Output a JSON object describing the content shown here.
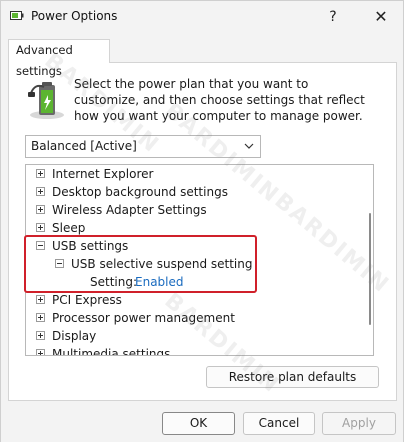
{
  "window": {
    "title": "Power Options",
    "help_glyph": "?",
    "close_glyph": "✕"
  },
  "tab": {
    "label": "Advanced settings"
  },
  "description": "Select the power plan that you want to customize, and then choose settings that reflect how you want your computer to manage power.",
  "plan_select": {
    "value": "Balanced [Active]"
  },
  "tree": {
    "items": [
      {
        "label": "Internet Explorer",
        "expanded": false,
        "level": 0
      },
      {
        "label": "Desktop background settings",
        "expanded": false,
        "level": 0
      },
      {
        "label": "Wireless Adapter Settings",
        "expanded": false,
        "level": 0
      },
      {
        "label": "Sleep",
        "expanded": false,
        "level": 0
      },
      {
        "label": "USB settings",
        "expanded": true,
        "level": 0
      },
      {
        "label": "USB selective suspend setting",
        "expanded": true,
        "level": 1
      },
      {
        "setting_label": "Setting:",
        "setting_value": "Enabled",
        "level": 2
      },
      {
        "label": "PCI Express",
        "expanded": false,
        "level": 0
      },
      {
        "label": "Processor power management",
        "expanded": false,
        "level": 0
      },
      {
        "label": "Display",
        "expanded": false,
        "level": 0
      },
      {
        "label": "Multimedia settings",
        "expanded": false,
        "level": 0
      }
    ]
  },
  "buttons": {
    "restore": "Restore plan defaults",
    "ok": "OK",
    "cancel": "Cancel",
    "apply": "Apply"
  },
  "watermark_text": "BARDIMIN",
  "colors": {
    "highlight": "#d0202a",
    "link": "#1a6bbf",
    "battery": "#5cb531"
  }
}
